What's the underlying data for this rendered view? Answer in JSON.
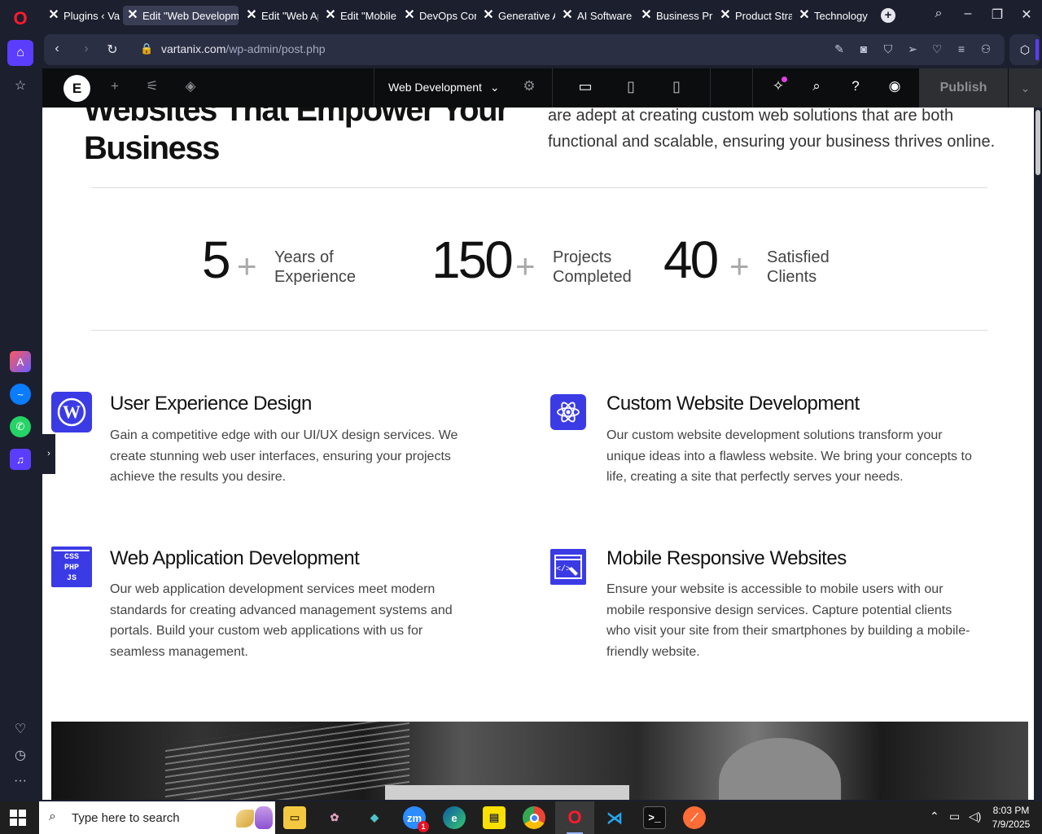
{
  "browser": {
    "tabs": [
      {
        "label": "Plugins ‹ Vart",
        "active": false
      },
      {
        "label": "Edit \"Web Developme",
        "active": true
      },
      {
        "label": "Edit \"Web Ap",
        "active": false
      },
      {
        "label": "Edit \"Mobile",
        "active": false
      },
      {
        "label": "DevOps Con",
        "active": false
      },
      {
        "label": "Generative A",
        "active": false
      },
      {
        "label": "AI Software",
        "active": false
      },
      {
        "label": "Business Pro",
        "active": false
      },
      {
        "label": "Product Strat",
        "active": false
      },
      {
        "label": "Technology S",
        "active": false
      }
    ],
    "url_host": "vartanix.com",
    "url_path": "/wp-admin/post.php"
  },
  "elementor": {
    "document_title": "Web Development",
    "publish_label": "Publish"
  },
  "page": {
    "hero_title_line1": "Websites That Empower Your",
    "hero_title_line2": "Business",
    "hero_desc_line1": "are adept at creating custom web solutions that are both",
    "hero_desc_line2": "functional and scalable, ensuring your business thrives online.",
    "stats": [
      {
        "number": "5",
        "plus": "+",
        "label_line1": "Years of",
        "label_line2": "Experience"
      },
      {
        "number": "150",
        "plus": "+",
        "label_line1": "Projects",
        "label_line2": "Completed"
      },
      {
        "number": "40",
        "plus": "+",
        "label_line1": "Satisfied",
        "label_line2": "Clients"
      }
    ],
    "services": [
      {
        "title": "User Experience Design",
        "text": "Gain a competitive edge with our UI/UX design services. We create stunning web user interfaces, ensuring your projects achieve the results you desire.",
        "icon": "wordpress-icon"
      },
      {
        "title": "Custom Website Development",
        "text": "Our custom website development solutions transform your unique ideas into a flawless website. We bring your concepts to life, creating a site that perfectly serves your needs.",
        "icon": "atom-icon"
      },
      {
        "title": "Web Application Development",
        "text": "Our web application development services meet modern standards for creating advanced management systems and portals. Build your custom web applications with us for seamless management.",
        "icon": "css-php-js-icon",
        "icon_lines": [
          "CSS",
          "PHP",
          "JS"
        ]
      },
      {
        "title": "Mobile Responsive Websites",
        "text": "Ensure your website is accessible to mobile users with our mobile responsive design services. Capture potential clients who visit your site from their smartphones by building a mobile-friendly website.",
        "icon": "code-wrench-icon"
      }
    ]
  },
  "taskbar": {
    "search_placeholder": "Type here to search",
    "zoom_badge": "1",
    "time": "8:03 PM",
    "date": "7/9/2025"
  },
  "colors": {
    "accent": "#3b3be6",
    "opera_red": "#ff1b2d",
    "opera_purple": "#5b3dff"
  }
}
